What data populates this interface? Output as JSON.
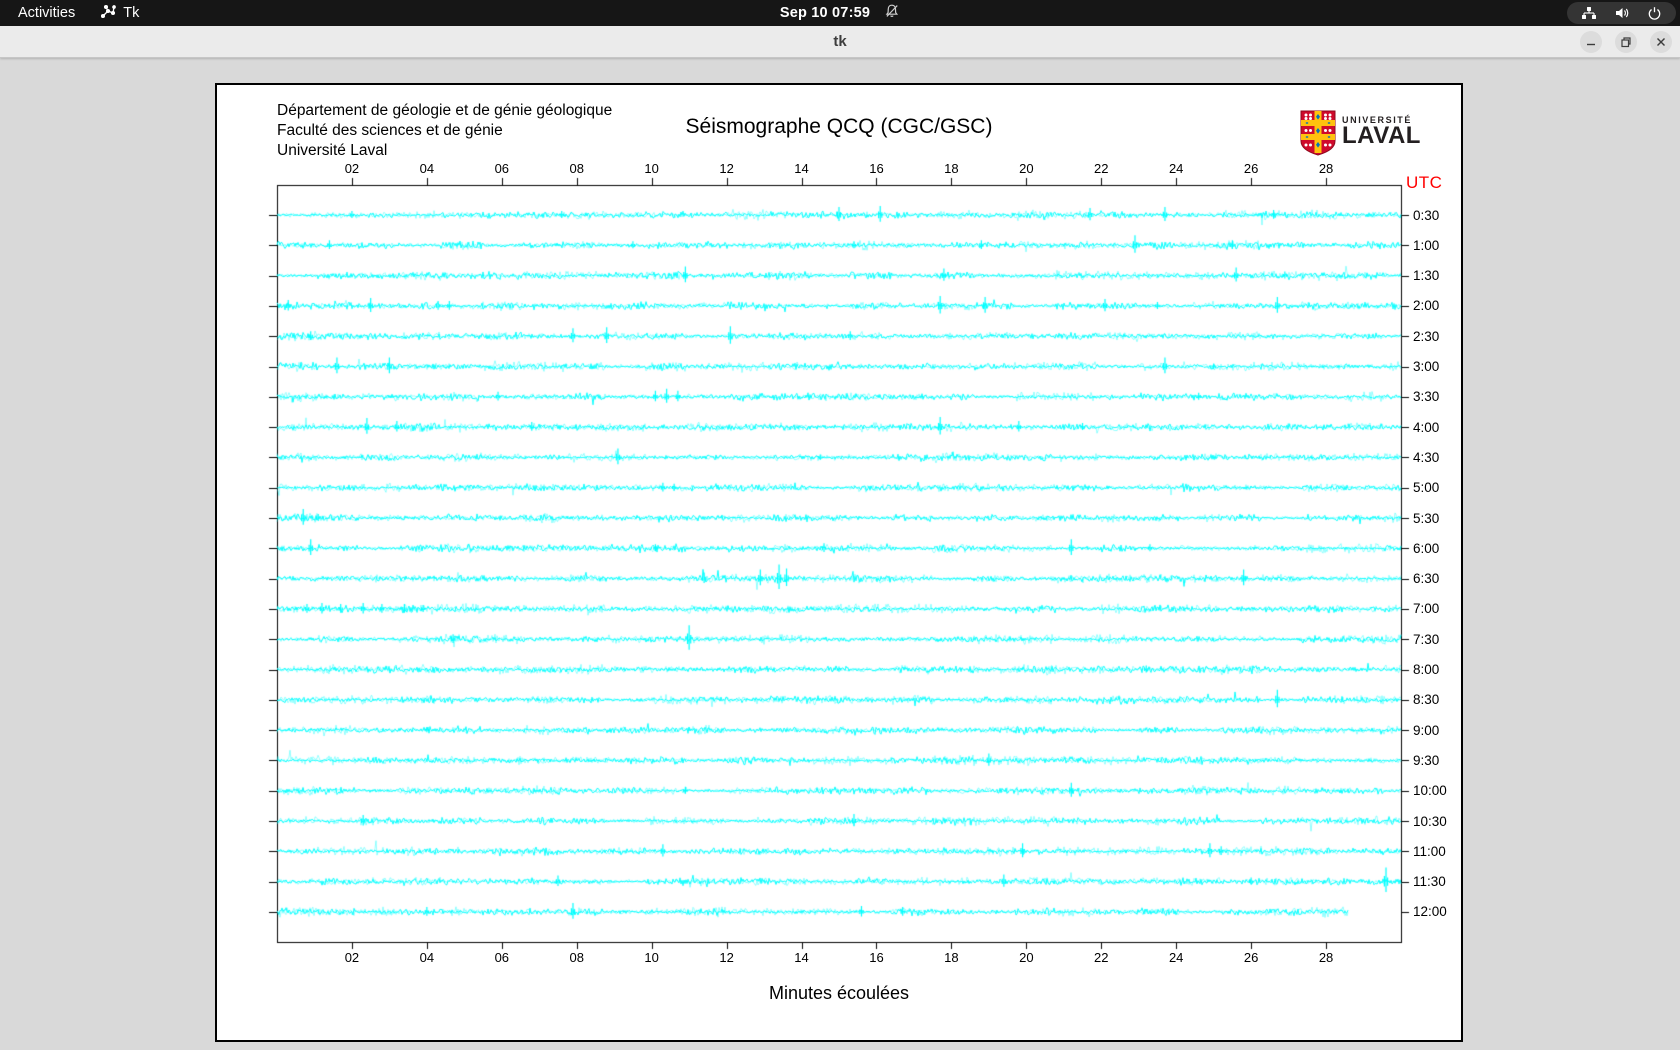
{
  "topbar": {
    "activities_label": "Activities",
    "app_name": "Tk",
    "clock": "Sep 10 07:59",
    "icons": [
      "tk-app-icon",
      "notifications-disabled-icon",
      "network-icon",
      "volume-icon",
      "power-icon"
    ]
  },
  "titlebar": {
    "title": "tk",
    "buttons": [
      "minimize",
      "restore",
      "close"
    ]
  },
  "app": {
    "header_lines": [
      "Département de géologie et de génie géologique",
      "Faculté des sciences et de génie",
      "Université Laval"
    ],
    "title": "Séismographe QCQ (CGC/GSC)",
    "utc_label": "UTC",
    "x_axis_label": "Minutes écoulées",
    "logo": {
      "line1": "UNIVERSITÉ",
      "line2": "LAVAL"
    }
  },
  "colors": {
    "trace": "#00ffff",
    "utc": "#ff0000",
    "axis": "#000000",
    "canvas_bg": "#ffffff",
    "window_bg": "#d9d9d9",
    "topbar_bg": "#161616",
    "titlebar_bg": "#ebebeb",
    "logo_red": "#cf0a2c",
    "logo_gold": "#ffc20e",
    "logo_blue": "#0072bc"
  },
  "chart_data": {
    "type": "line",
    "subtype": "seismogram-helicorder",
    "title": "Séismographe QCQ (CGC/GSC)",
    "xlabel": "Minutes écoulées",
    "x_range": [
      0,
      30
    ],
    "x_tick_minutes": [
      2,
      4,
      6,
      8,
      10,
      12,
      14,
      16,
      18,
      20,
      22,
      24,
      26,
      28
    ],
    "x_tick_labels": [
      "02",
      "04",
      "06",
      "08",
      "10",
      "12",
      "14",
      "16",
      "18",
      "20",
      "22",
      "24",
      "26",
      "28"
    ],
    "y_axis_side": "right",
    "y_axis_title": "UTC",
    "grid": false,
    "rows": [
      {
        "label": "0:30",
        "end": 30,
        "spikes": [
          [
            2.0,
            4
          ],
          [
            7.6,
            4
          ],
          [
            15.0,
            8
          ],
          [
            16.1,
            9
          ],
          [
            21.7,
            7
          ],
          [
            23.7,
            8
          ],
          [
            26.6,
            5
          ]
        ]
      },
      {
        "label": "1:00",
        "end": 30,
        "spikes": [
          [
            1.4,
            5
          ],
          [
            9.5,
            4
          ],
          [
            15.4,
            4
          ],
          [
            18.8,
            5
          ],
          [
            22.9,
            10
          ],
          [
            25.5,
            5
          ]
        ]
      },
      {
        "label": "1:30",
        "end": 30,
        "spikes": [
          [
            10.9,
            9
          ],
          [
            17.8,
            7
          ],
          [
            25.6,
            8
          ],
          [
            26.9,
            4
          ]
        ]
      },
      {
        "label": "2:00",
        "end": 30,
        "spikes": [
          [
            0.3,
            6
          ],
          [
            2.5,
            8
          ],
          [
            4.3,
            5
          ],
          [
            4.6,
            5
          ],
          [
            17.7,
            10
          ],
          [
            18.9,
            9
          ],
          [
            22.1,
            7
          ],
          [
            23.5,
            4
          ],
          [
            26.7,
            9
          ]
        ]
      },
      {
        "label": "2:30",
        "end": 30,
        "spikes": [
          [
            0.9,
            5
          ],
          [
            7.9,
            8
          ],
          [
            8.8,
            9
          ],
          [
            12.1,
            10
          ],
          [
            15.3,
            5
          ]
        ]
      },
      {
        "label": "3:00",
        "end": 30,
        "spikes": [
          [
            1.6,
            9
          ],
          [
            3.0,
            9
          ],
          [
            23.7,
            9
          ],
          [
            25.0,
            3
          ]
        ]
      },
      {
        "label": "3:30",
        "end": 30,
        "spikes": [
          [
            5.9,
            5
          ],
          [
            10.1,
            6
          ],
          [
            10.4,
            8
          ],
          [
            10.7,
            6
          ],
          [
            24.6,
            4
          ]
        ]
      },
      {
        "label": "4:00",
        "end": 30,
        "spikes": [
          [
            2.4,
            9
          ],
          [
            3.2,
            6
          ],
          [
            6.8,
            5
          ],
          [
            17.7,
            10
          ],
          [
            19.8,
            6
          ],
          [
            21.5,
            4
          ]
        ]
      },
      {
        "label": "4:30",
        "end": 30,
        "spikes": [
          [
            9.1,
            9
          ],
          [
            14.5,
            3
          ]
        ]
      },
      {
        "label": "5:00",
        "end": 30,
        "spikes": [
          [
            10.3,
            5
          ],
          [
            10.6,
            4
          ]
        ]
      },
      {
        "label": "5:30",
        "end": 30,
        "spikes": [
          [
            0.7,
            9
          ],
          [
            1.1,
            4
          ]
        ]
      },
      {
        "label": "6:00",
        "end": 30,
        "spikes": [
          [
            0.9,
            9
          ],
          [
            10.1,
            4
          ],
          [
            14.6,
            5
          ],
          [
            21.2,
            9
          ],
          [
            23.3,
            4
          ]
        ]
      },
      {
        "label": "6:30",
        "end": 30,
        "spikes": [
          [
            11.4,
            6
          ],
          [
            12.9,
            9
          ],
          [
            13.4,
            14
          ],
          [
            13.6,
            10
          ],
          [
            25.8,
            9
          ]
        ]
      },
      {
        "label": "7:00",
        "end": 30,
        "spikes": [
          [
            0.8,
            5
          ],
          [
            1.2,
            6
          ],
          [
            1.7,
            5
          ],
          [
            2.3,
            6
          ],
          [
            2.8,
            5
          ],
          [
            3.4,
            5
          ],
          [
            3.9,
            4
          ]
        ]
      },
      {
        "label": "7:30",
        "end": 30,
        "spikes": [
          [
            4.7,
            5
          ],
          [
            11.0,
            14
          ]
        ]
      },
      {
        "label": "8:00",
        "end": 30,
        "spikes": [
          [
            15.0,
            3
          ],
          [
            23.2,
            4
          ]
        ]
      },
      {
        "label": "8:30",
        "end": 30,
        "spikes": [
          [
            26.7,
            10
          ]
        ]
      },
      {
        "label": "9:00",
        "end": 30,
        "spikes": [
          [
            4.0,
            3
          ]
        ]
      },
      {
        "label": "9:30",
        "end": 30,
        "spikes": [
          [
            19.0,
            7
          ]
        ]
      },
      {
        "label": "10:00",
        "end": 30,
        "spikes": [
          [
            10.9,
            4
          ],
          [
            21.2,
            8
          ]
        ]
      },
      {
        "label": "10:30",
        "end": 30,
        "spikes": [
          [
            2.3,
            6
          ],
          [
            15.4,
            7
          ]
        ]
      },
      {
        "label": "11:00",
        "end": 30,
        "spikes": [
          [
            10.3,
            7
          ],
          [
            19.9,
            8
          ],
          [
            24.9,
            8
          ],
          [
            25.2,
            5
          ]
        ]
      },
      {
        "label": "11:30",
        "end": 30,
        "spikes": [
          [
            7.5,
            6
          ],
          [
            19.4,
            7
          ],
          [
            26.0,
            4
          ],
          [
            29.6,
            14
          ]
        ]
      },
      {
        "label": "12:00",
        "end": 28.6,
        "spikes": [
          [
            4.0,
            5
          ],
          [
            7.9,
            9
          ],
          [
            15.6,
            6
          ],
          [
            16.7,
            5
          ]
        ]
      }
    ]
  }
}
